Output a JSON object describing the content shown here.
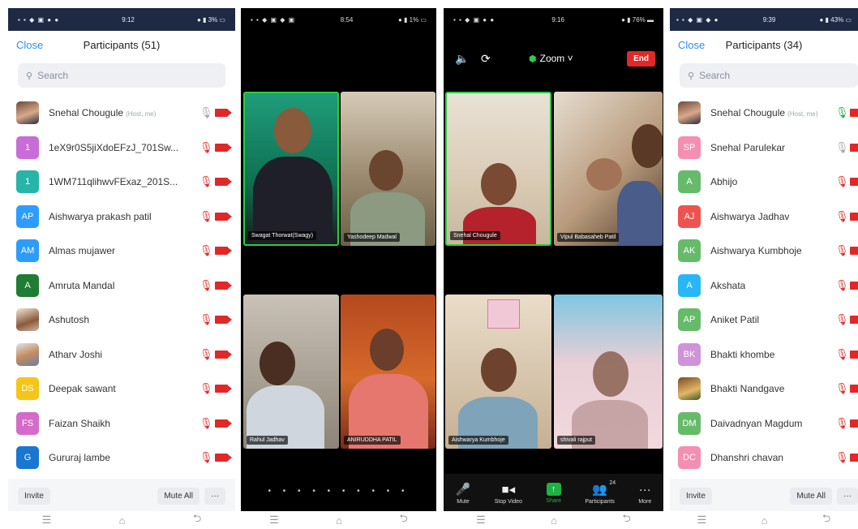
{
  "screens": {
    "s1": {
      "status": {
        "time": "9:12",
        "icons": "▪ ▪ ◆ ▣ ● ●",
        "right": "● ▮ 3% ▭"
      },
      "close": "Close",
      "title": "Participants (51)",
      "search_placeholder": "Search",
      "rows": [
        {
          "name": "Snehal Chougule",
          "tag": "(Host, me)",
          "initial": "",
          "color": "",
          "mic": "on-grey"
        },
        {
          "name": "1eX9r0S5jiXdoEFzJ_701Sw...",
          "tag": "",
          "initial": "1",
          "color": "#c86dd7",
          "mic": "off"
        },
        {
          "name": "1WM711qlihwvFExaz_201S...",
          "tag": "",
          "initial": "1",
          "color": "#26b5a7",
          "mic": "off"
        },
        {
          "name": "Aishwarya prakash patil",
          "tag": "",
          "initial": "AP",
          "color": "#2d9cff",
          "mic": "off"
        },
        {
          "name": "Almas mujawer",
          "tag": "",
          "initial": "AM",
          "color": "#2d9cff",
          "mic": "off"
        },
        {
          "name": "Amruta Mandal",
          "tag": "",
          "initial": "A",
          "color": "#1e7d32",
          "mic": "off"
        },
        {
          "name": "Ashutosh",
          "tag": "",
          "initial": "",
          "color": "",
          "mic": "off"
        },
        {
          "name": "Atharv Joshi",
          "tag": "",
          "initial": "",
          "color": "",
          "mic": "off"
        },
        {
          "name": "Deepak sawant",
          "tag": "",
          "initial": "DS",
          "color": "#f5c518",
          "mic": "off"
        },
        {
          "name": "Faizan Shaikh",
          "tag": "",
          "initial": "FS",
          "color": "#d46bc9",
          "mic": "off"
        },
        {
          "name": "Gururaj lambe",
          "tag": "",
          "initial": "G",
          "color": "#1976d2",
          "mic": "off"
        }
      ],
      "invite": "Invite",
      "mute_all": "Mute All",
      "more": "···"
    },
    "s2": {
      "status": {
        "time": "8:54",
        "icons": "▪ ▪ ◆ ▣ ◆ ▣",
        "right": "● ▮ 1% ▭"
      },
      "tiles": [
        "Swagat Thorwat(Swagy)",
        "Yashodeep Madwal",
        "Rahul Jadhav",
        "ANIRUDDHA PATIL"
      ],
      "dots": "• • • • • • • • • •"
    },
    "s3": {
      "status": {
        "time": "9:16",
        "icons": "▪ ▪ ◆ ▣ ● ●",
        "right": "● ▮ 76% ▬"
      },
      "app": "Zoom ˅",
      "end": "End",
      "tiles": [
        "Snehal Chougule",
        "Vipul Babasaheb Patil",
        "Aishwarya Kumbhoje",
        "shivali rajput"
      ],
      "toolbar": [
        {
          "icon": "🎤",
          "label": "Mute"
        },
        {
          "icon": "■◂",
          "label": "Stop Video"
        },
        {
          "icon": "↑",
          "label": "Share"
        },
        {
          "icon": "👥",
          "label": "Participants"
        },
        {
          "icon": "···",
          "label": "More"
        }
      ],
      "participants_count": "24"
    },
    "s4": {
      "status": {
        "time": "9:39",
        "icons": "▪ ▪ ◆ ▣ ◆ ●",
        "right": "● ▮ 43% ▭"
      },
      "close": "Close",
      "title": "Participants (34)",
      "search_placeholder": "Search",
      "rows": [
        {
          "name": "Snehal Chougule",
          "tag": "(Host, me)",
          "initial": "",
          "color": "",
          "mic": "on-green"
        },
        {
          "name": "Snehal Parulekar",
          "tag": "",
          "initial": "SP",
          "color": "#f48fb1",
          "mic": "on-grey"
        },
        {
          "name": "Abhijo",
          "tag": "",
          "initial": "A",
          "color": "#66bb6a",
          "mic": "off"
        },
        {
          "name": "Aishwarya Jadhav",
          "tag": "",
          "initial": "AJ",
          "color": "#ef5350",
          "mic": "off"
        },
        {
          "name": "Aishwarya Kumbhoje",
          "tag": "",
          "initial": "AK",
          "color": "#66bb6a",
          "mic": "off"
        },
        {
          "name": "Akshata",
          "tag": "",
          "initial": "A",
          "color": "#29b6f6",
          "mic": "off"
        },
        {
          "name": "Aniket Patil",
          "tag": "",
          "initial": "AP",
          "color": "#66bb6a",
          "mic": "off"
        },
        {
          "name": "Bhakti khombe",
          "tag": "",
          "initial": "BK",
          "color": "#ce93d8",
          "mic": "off"
        },
        {
          "name": "Bhakti Nandgave",
          "tag": "",
          "initial": "",
          "color": "",
          "mic": "off"
        },
        {
          "name": "Daivadnyan Magdum",
          "tag": "",
          "initial": "DM",
          "color": "#66bb6a",
          "mic": "off"
        },
        {
          "name": "Dhanshri chavan",
          "tag": "",
          "initial": "DC",
          "color": "#f48fb1",
          "mic": "off"
        }
      ],
      "invite": "Invite",
      "mute_all": "Mute All",
      "more": "···"
    }
  },
  "nav": {
    "menu": "☰",
    "home": "⌂",
    "back": "⮌"
  }
}
